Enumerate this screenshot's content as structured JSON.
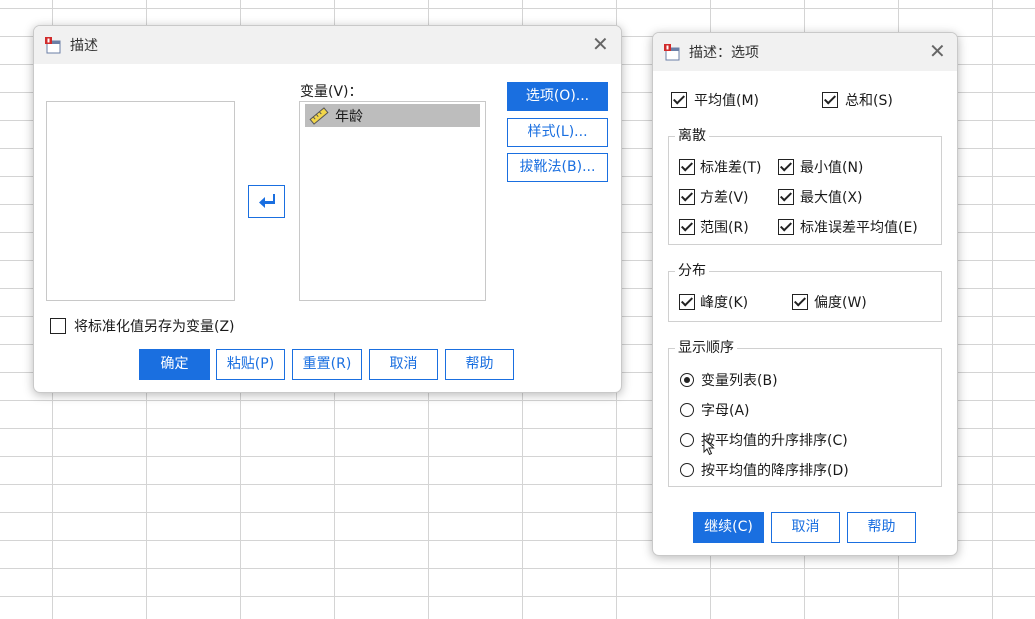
{
  "colors": {
    "accent": "#1a6fe0",
    "titlebar": "#f1f1f1"
  },
  "describe_dialog": {
    "title": "描述",
    "close_icon": "close-icon",
    "variables_label": "变量(V)：",
    "variables": [
      "年龄"
    ],
    "variable_icon": "scale-ruler-icon",
    "move_arrow_icon": "arrow-left-icon",
    "side_buttons": {
      "options": "选项(O)...",
      "style": "样式(L)...",
      "bootstrap": "拔靴法(B)..."
    },
    "save_standardized": {
      "label": "将标准化值另存为变量(Z)",
      "checked": false
    },
    "bottom_buttons": {
      "ok": "确定",
      "paste": "粘贴(P)",
      "reset": "重置(R)",
      "cancel": "取消",
      "help": "帮助"
    }
  },
  "options_dialog": {
    "title": "描述：选项",
    "close_icon": "close-icon",
    "mean": {
      "label": "平均值(M)",
      "checked": true
    },
    "sum": {
      "label": "总和(S)",
      "checked": true
    },
    "dispersion": {
      "title": "离散",
      "std_dev": {
        "label": "标准差(T)",
        "checked": true
      },
      "minimum": {
        "label": "最小值(N)",
        "checked": true
      },
      "variance": {
        "label": "方差(V)",
        "checked": true
      },
      "maximum": {
        "label": "最大值(X)",
        "checked": true
      },
      "range": {
        "label": "范围(R)",
        "checked": true
      },
      "se_mean": {
        "label": "标准误差平均值(E)",
        "checked": true
      }
    },
    "distribution": {
      "title": "分布",
      "kurtosis": {
        "label": "峰度(K)",
        "checked": true
      },
      "skewness": {
        "label": "偏度(W)",
        "checked": true
      }
    },
    "display_order": {
      "title": "显示顺序",
      "options": [
        {
          "label": "变量列表(B)",
          "selected": true
        },
        {
          "label": "字母(A)",
          "selected": false
        },
        {
          "label": "按平均值的升序排序(C)",
          "selected": false
        },
        {
          "label": "按平均值的降序排序(D)",
          "selected": false
        }
      ]
    },
    "buttons": {
      "continue": "继续(C)",
      "cancel": "取消",
      "help": "帮助"
    }
  }
}
